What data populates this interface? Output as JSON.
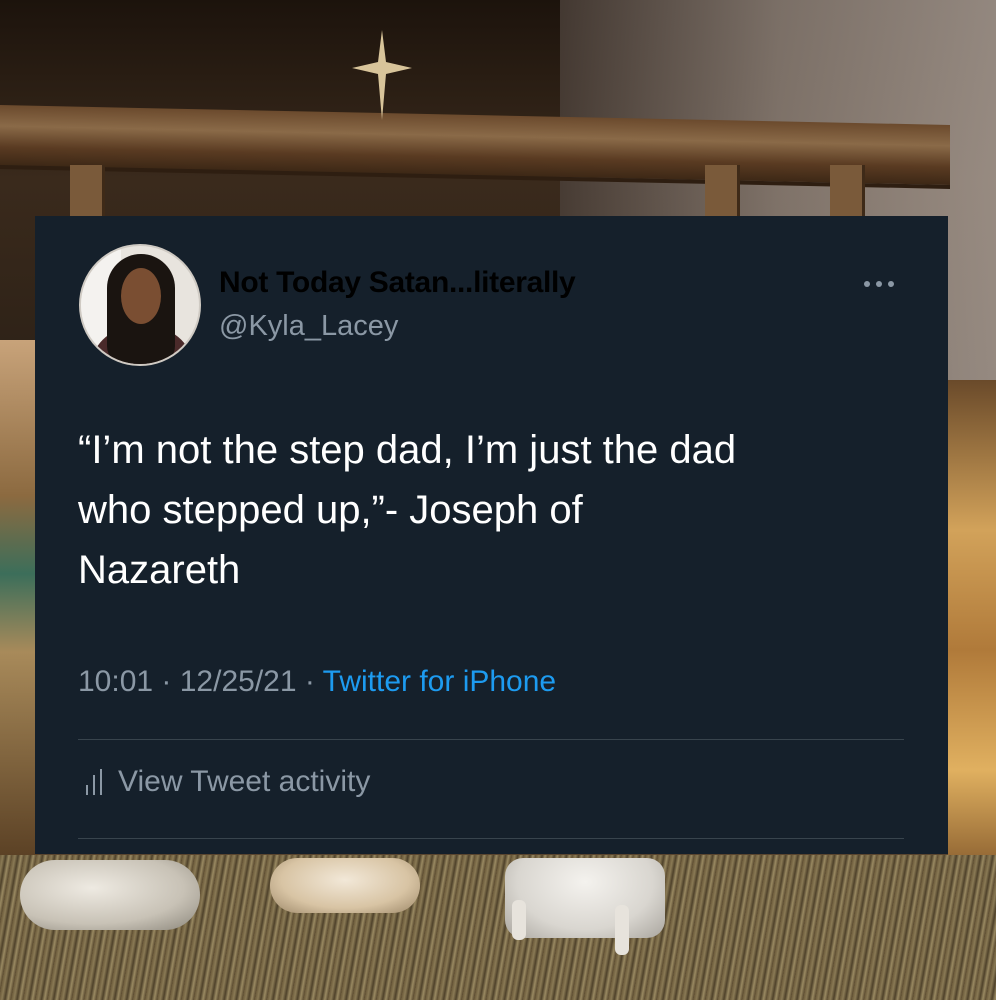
{
  "tweet": {
    "display_name": "Not Today Satan...literally",
    "handle": "@Kyla_Lacey",
    "text_lines": [
      "“I’m not the step dad, I’m just the dad",
      "who stepped up,”- Joseph of",
      "Nazareth"
    ],
    "time": "10:01",
    "date": "12/25/21",
    "separator": "·",
    "source": "Twitter for iPhone",
    "activity_label": "View Tweet activity"
  },
  "icons": {
    "more": "more-horizontal-icon",
    "activity": "bar-chart-icon"
  },
  "colors": {
    "card_background": "#15202b",
    "text_primary": "#ffffff",
    "text_secondary": "#8b98a5",
    "link": "#1d9bf0",
    "divider": "#38444d"
  }
}
